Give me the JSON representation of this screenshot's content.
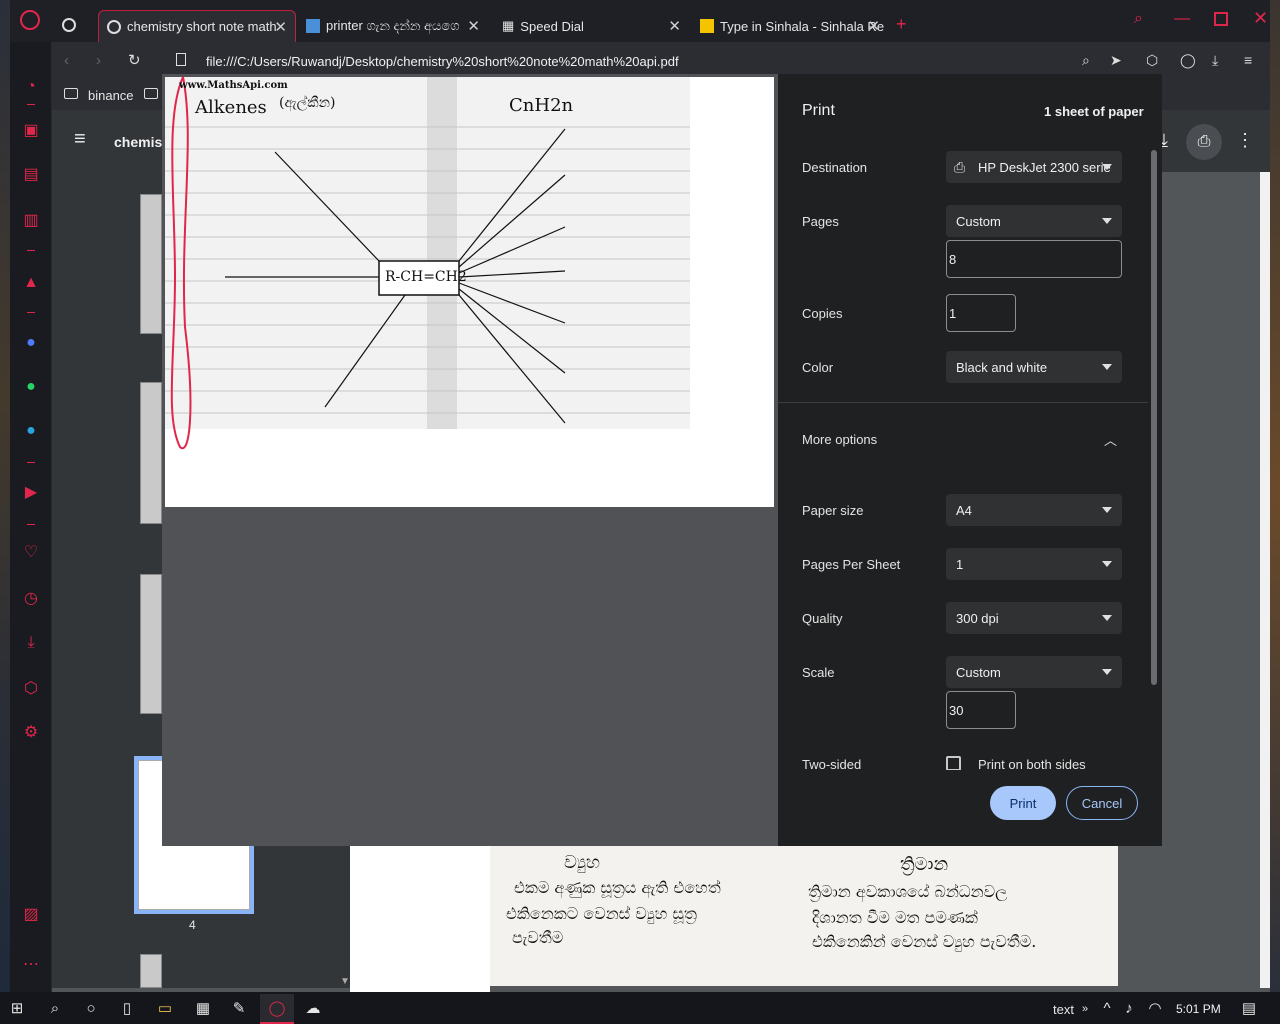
{
  "tabs": [
    {
      "title": "chemistry short note math"
    },
    {
      "title": "printer ගැන දන්න අයගෙ"
    },
    {
      "title": "Speed Dial"
    },
    {
      "title": "Type in Sinhala - Sinhala Re"
    }
  ],
  "address": {
    "url": "file:///C:/Users/Ruwandj/Desktop/chemistry%20short%20note%20math%20api.pdf"
  },
  "bookmarks": [
    {
      "label": "binance"
    }
  ],
  "pdf": {
    "title": "chemis",
    "page_label": "4"
  },
  "preview": {
    "watermark": "www.MathsApi.com",
    "heading": "Alkenes",
    "heading_si": "(ඇල්කීන)",
    "formula": "CnH2n",
    "center": "R-CH=CH2"
  },
  "print": {
    "title": "Print",
    "sheets": "1 sheet of paper",
    "destination_label": "Destination",
    "destination_value": "HP DeskJet 2300 serie",
    "pages_label": "Pages",
    "pages_value": "Custom",
    "pages_input": "8",
    "copies_label": "Copies",
    "copies_value": "1",
    "color_label": "Color",
    "color_value": "Black and white",
    "more_options": "More options",
    "paper_size_label": "Paper size",
    "paper_size_value": "A4",
    "pps_label": "Pages Per Sheet",
    "pps_value": "1",
    "quality_label": "Quality",
    "quality_value": "300 dpi",
    "scale_label": "Scale",
    "scale_value": "Custom",
    "scale_input": "30",
    "two_sided_label": "Two-sided",
    "two_sided_option": "Print on both sides",
    "print_button": "Print",
    "cancel_button": "Cancel"
  },
  "background_doc": {
    "col1_head": "ව්‍යුහ",
    "col2_head": "ත්‍රිමාන",
    "line1a": "එකම අණුක සූත්‍රය ඇති එහෙත්",
    "line1b": "ත්‍රිමාන අවකාශයේ බන්ධනවල",
    "line2a": "එකිනෙකට වෙනස් ව්‍යුහ සූත්‍ර",
    "line2b": "දිශානත වීම මත පමණක්",
    "line3a": "පැවතීම",
    "line3b": "එකිනෙකින් වෙනස් ව්‍යුහ පැවතීම."
  },
  "taskbar": {
    "tray_text": "text",
    "time": "5:01 PM"
  },
  "colors": {
    "accent": "#e0264a",
    "print_blue": "#a8c7fa",
    "dialog_bg": "#1f2021"
  }
}
